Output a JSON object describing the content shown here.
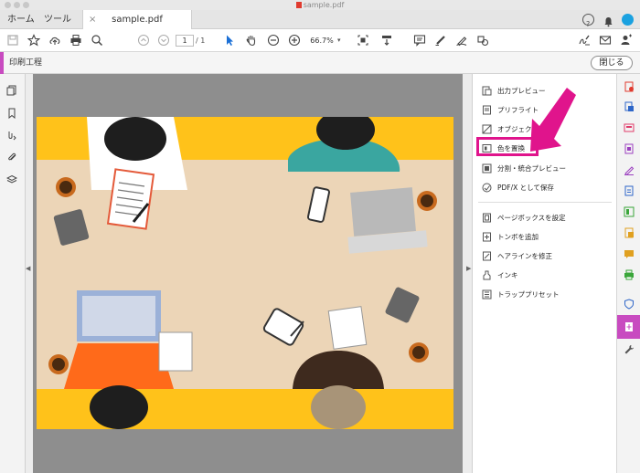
{
  "window": {
    "title": "sample.pdf"
  },
  "tabs": {
    "home": "ホーム",
    "tools": "ツール",
    "document": "sample.pdf",
    "close_glyph": "×"
  },
  "toolbar": {
    "page_current": "1",
    "page_total": "/ 1",
    "zoom": "66.7%"
  },
  "subbar": {
    "title": "印刷工程",
    "close_button": "閉じる"
  },
  "panel": {
    "items": [
      {
        "label": "出力プレビュー",
        "icon": "output-preview-icon"
      },
      {
        "label": "プリフライト",
        "icon": "preflight-icon"
      },
      {
        "label": "オブジェクト",
        "icon": "object-icon"
      },
      {
        "label": "色を置換",
        "icon": "replace-color-icon"
      },
      {
        "label": "分割・統合プレビュー",
        "icon": "flatten-preview-icon"
      },
      {
        "label": "PDF/X として保存",
        "icon": "save-pdfx-icon"
      },
      {
        "label": "ページボックスを設定",
        "icon": "page-box-icon"
      },
      {
        "label": "トンボを追加",
        "icon": "add-marks-icon"
      },
      {
        "label": "ヘアラインを修正",
        "icon": "fix-hairline-icon"
      },
      {
        "label": "インキ",
        "icon": "ink-icon"
      },
      {
        "label": "トラッププリセット",
        "icon": "trap-presets-icon"
      }
    ]
  },
  "colors": {
    "accent": "#c84bc0",
    "highlight": "#e0148c",
    "page_bg": "#ecd5b7",
    "page_stripe": "#ffc21a",
    "doc_bg": "#8e8e8e"
  }
}
